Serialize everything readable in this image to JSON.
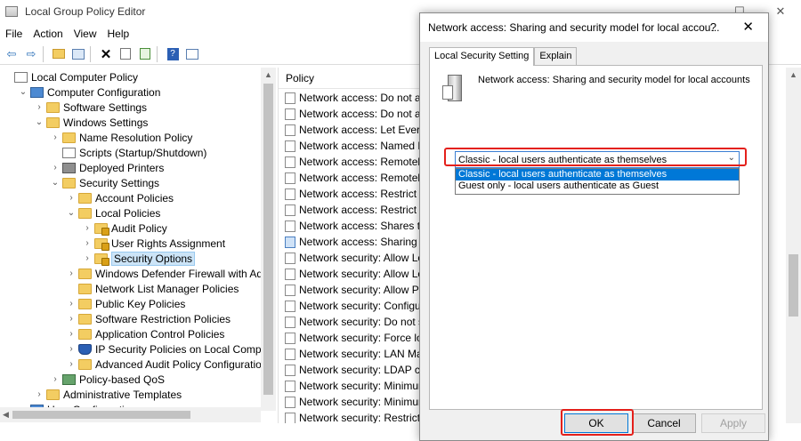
{
  "app": {
    "title": "Local Group Policy Editor",
    "window_controls": [
      "—",
      "☐",
      "✕"
    ]
  },
  "menu": [
    "File",
    "Action",
    "View",
    "Help"
  ],
  "tree": [
    {
      "label": "Local Computer Policy",
      "chev": "",
      "icon": "doc",
      "level": 0
    },
    {
      "label": "Computer Configuration",
      "chev": "⌄",
      "icon": "computer",
      "level": 1
    },
    {
      "label": "Software Settings",
      "chev": "›",
      "icon": "folder",
      "level": 2
    },
    {
      "label": "Windows Settings",
      "chev": "⌄",
      "icon": "folder",
      "level": 2
    },
    {
      "label": "Name Resolution Policy",
      "chev": "›",
      "icon": "folder",
      "level": 3
    },
    {
      "label": "Scripts (Startup/Shutdown)",
      "chev": "",
      "icon": "doc",
      "level": 3
    },
    {
      "label": "Deployed Printers",
      "chev": "›",
      "icon": "printer",
      "level": 3
    },
    {
      "label": "Security Settings",
      "chev": "⌄",
      "icon": "folder",
      "level": 3
    },
    {
      "label": "Account Policies",
      "chev": "›",
      "icon": "folder",
      "level": 4
    },
    {
      "label": "Local Policies",
      "chev": "⌄",
      "icon": "folder",
      "level": 4
    },
    {
      "label": "Audit Policy",
      "chev": "›",
      "icon": "folder-lock",
      "level": 5
    },
    {
      "label": "User Rights Assignment",
      "chev": "›",
      "icon": "folder-lock",
      "level": 5
    },
    {
      "label": "Security Options",
      "chev": "›",
      "icon": "folder-lock",
      "level": 5,
      "selected": true
    },
    {
      "label": "Windows Defender Firewall with Advanc",
      "chev": "›",
      "icon": "folder",
      "level": 4
    },
    {
      "label": "Network List Manager Policies",
      "chev": "",
      "icon": "folder",
      "level": 4
    },
    {
      "label": "Public Key Policies",
      "chev": "›",
      "icon": "folder",
      "level": 4
    },
    {
      "label": "Software Restriction Policies",
      "chev": "›",
      "icon": "folder",
      "level": 4
    },
    {
      "label": "Application Control Policies",
      "chev": "›",
      "icon": "folder",
      "level": 4
    },
    {
      "label": "IP Security Policies on Local Computer",
      "chev": "›",
      "icon": "shield",
      "level": 4
    },
    {
      "label": "Advanced Audit Policy Configuration",
      "chev": "›",
      "icon": "folder",
      "level": 4
    },
    {
      "label": "Policy-based QoS",
      "chev": "›",
      "icon": "qos",
      "level": 3
    },
    {
      "label": "Administrative Templates",
      "chev": "›",
      "icon": "folder",
      "level": 2
    },
    {
      "label": "User Configuration",
      "chev": "›",
      "icon": "computer",
      "level": 1
    }
  ],
  "list": {
    "header": "Policy",
    "rows": [
      "Network access: Do not allo",
      "Network access: Do not allo",
      "Network access: Let Everyor",
      "Network access: Named Pip",
      "Network access: Remotely a",
      "Network access: Remotely a",
      "Network access: Restrict and",
      "Network access: Restrict clie",
      "Network access: Shares that",
      "Network access: Sharing and",
      "Network security: Allow Loc",
      "Network security: Allow Loc",
      "Network security: Allow PKU",
      "Network security: Configure",
      "Network security: Do not sto",
      "Network security: Force logo",
      "Network security: LAN Man",
      "Network security: LDAP clie",
      "Network security: Minimum",
      "Network security: Minimum",
      "Network security: Restrict N"
    ]
  },
  "dialog": {
    "title": "Network access: Sharing and security model for local accou...",
    "help": "?",
    "close": "✕",
    "tabs": [
      "Local Security Setting",
      "Explain"
    ],
    "policy_name": "Network access: Sharing and security model for local accounts",
    "combo_value": "Classic - local users authenticate as themselves",
    "options": [
      "Classic - local users authenticate as themselves",
      "Guest only - local users authenticate as Guest"
    ],
    "buttons": {
      "ok": "OK",
      "cancel": "Cancel",
      "apply": "Apply"
    }
  }
}
